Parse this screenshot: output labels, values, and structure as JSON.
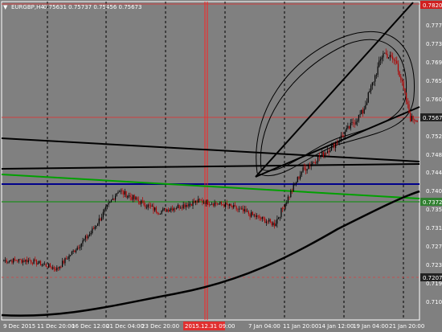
{
  "header": {
    "arrow_glyph": "▼",
    "symbol": "EURGBP,H4",
    "ohlc": "0.75631 0.75737 0.75456 0.75673"
  },
  "colors": {
    "background": "#808080",
    "foreground": "#ffffff",
    "grid": "#000000",
    "candle_bull": "#000000",
    "candle_bear": "#b00000",
    "hline_red": "#d04040",
    "hline_blue": "#00008b",
    "hline_green": "#2e8b2e",
    "trend_green": "#00a000",
    "ma_line": "#000000",
    "price_label_red": "#d02020",
    "price_label_green": "#2f7f2f",
    "price_label_dark": "#222222",
    "time_label_red": "#e03030"
  },
  "price_axis": {
    "ticks": [
      "0.77770",
      "0.77350",
      "0.76930",
      "0.76510",
      "0.76090",
      "0.75252",
      "0.74842",
      "0.74420",
      "0.74000",
      "0.73590",
      "0.73170",
      "0.72750",
      "0.72330",
      "0.71910",
      "0.71080"
    ],
    "labels": [
      {
        "text": "0.78204",
        "style": "red"
      },
      {
        "text": "0.75673",
        "style": "dark"
      },
      {
        "text": "0.73725",
        "style": "green"
      },
      {
        "text": "0.72075",
        "style": "dark"
      }
    ]
  },
  "time_axis": {
    "labels": [
      "9 Dec 2015",
      "11 Dec 20:00",
      "16 Dec 12:00",
      "21 Dec 04:00",
      "23 Dec 20:00",
      "2015.12.31 09:00",
      "7 Jan 04:00",
      "11 Jan 20:00",
      "14 Jan 12:00",
      "19 Jan 04:00",
      "21 Jan 20:00"
    ],
    "highlight_label": "2015.12.31 09:00"
  },
  "chart_data": {
    "type": "candlestick",
    "price_range": [
      0.7095,
      0.7844
    ],
    "bars": 300,
    "segments": [
      {
        "bars": 20,
        "close": 0.7235,
        "vol": 0.0012
      },
      {
        "bars": 20,
        "close": 0.7215,
        "vol": 0.0012
      },
      {
        "bars": 25,
        "close": 0.73,
        "vol": 0.0013
      },
      {
        "bars": 20,
        "close": 0.74,
        "vol": 0.0015
      },
      {
        "bars": 30,
        "close": 0.735,
        "vol": 0.0014
      },
      {
        "bars": 30,
        "close": 0.7375,
        "vol": 0.0013
      },
      {
        "bars": 20,
        "close": 0.7365,
        "vol": 0.0013
      },
      {
        "bars": 20,
        "close": 0.734,
        "vol": 0.0014
      },
      {
        "bars": 15,
        "close": 0.732,
        "vol": 0.0013
      },
      {
        "bars": 20,
        "close": 0.7445,
        "vol": 0.0016
      },
      {
        "bars": 25,
        "close": 0.751,
        "vol": 0.0016
      },
      {
        "bars": 20,
        "close": 0.7585,
        "vol": 0.0017
      },
      {
        "bars": 15,
        "close": 0.7725,
        "vol": 0.0018
      },
      {
        "bars": 10,
        "close": 0.77,
        "vol": 0.0018
      },
      {
        "bars": 10,
        "close": 0.757,
        "vol": 0.0018
      },
      {
        "bars": 5,
        "close": 0.7567,
        "vol": 0.0015
      }
    ],
    "horizontal_lines": [
      {
        "price": 0.78204,
        "color": "red"
      },
      {
        "price": 0.75673,
        "color": "red"
      },
      {
        "price": 0.7412,
        "color": "blue"
      },
      {
        "price": 0.73725,
        "color": "green"
      },
      {
        "price": 0.72075,
        "color": "red-dashed"
      }
    ]
  }
}
